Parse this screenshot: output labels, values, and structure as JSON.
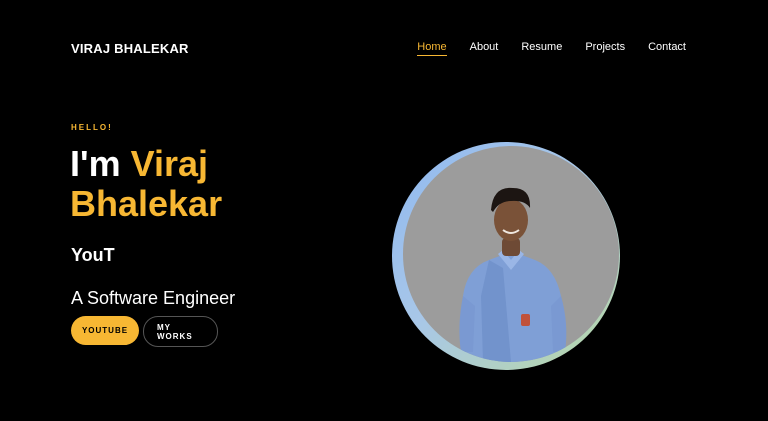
{
  "header": {
    "brand": "VIRAJ BHALEKAR",
    "nav": [
      "Home",
      "About",
      "Resume",
      "Projects",
      "Contact"
    ]
  },
  "hero": {
    "greeting": "HELLO!",
    "headline_prefix": "I'm ",
    "name_first": "Viraj",
    "name_last": "Bhalekar",
    "typed_text": "YouT",
    "role": "A Software Engineer",
    "primary_button": "YOUTUBE",
    "secondary_button": "MY WORKS"
  },
  "colors": {
    "background": "#000000",
    "accent": "#f7b733",
    "text": "#ffffff"
  }
}
